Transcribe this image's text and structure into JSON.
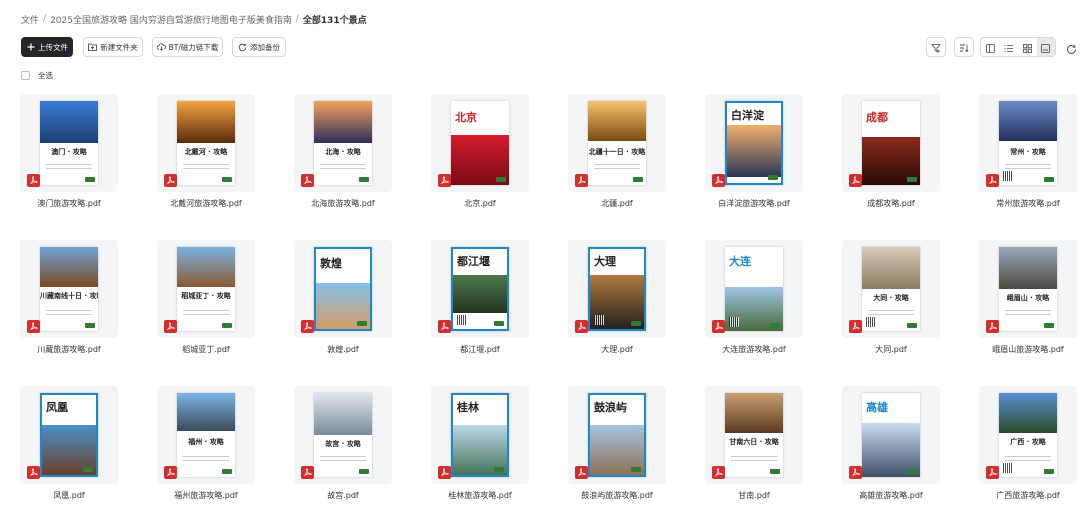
{
  "breadcrumb": {
    "root": "文件",
    "sep1": "/",
    "folder": "2025全国旅游攻略 国内穷游自驾游旅行地图电子版美食指南",
    "sep2": "/",
    "current": "全部131个景点"
  },
  "toolbar": {
    "upload": "上传文件",
    "new_folder": "新建文件夹",
    "bt_download": "BT/磁力链下载",
    "add_backup": "添加备份"
  },
  "select_all": "全选",
  "colors": {
    "primary_button": "#25262b",
    "pdf_red": "#d32f2f",
    "accent_blue": "#1e88c8"
  },
  "icons": [
    "plus-icon",
    "folder-plus-icon",
    "cloud-download-icon",
    "sync-icon",
    "filter-icon",
    "sort-icon",
    "split-view-icon",
    "list-view-icon",
    "grid-view-icon",
    "large-grid-view-icon",
    "refresh-icon",
    "pdf-icon"
  ],
  "files": [
    {
      "name": "澳门旅游攻略.pdf",
      "cover_title": "澳门 · 攻略"
    },
    {
      "name": "北戴河旅游攻略.pdf",
      "cover_title": "北戴河 · 攻略"
    },
    {
      "name": "北海旅游攻略.pdf",
      "cover_title": "北海 · 攻略"
    },
    {
      "name": "北京.pdf",
      "cover_title": "北京"
    },
    {
      "name": "北疆.pdf",
      "cover_title": "北疆十一日 · 攻略"
    },
    {
      "name": "白洋淀旅游攻略.pdf",
      "cover_title": "白洋淀"
    },
    {
      "name": "成都攻略.pdf",
      "cover_title": "成都"
    },
    {
      "name": "常州旅游攻略.pdf",
      "cover_title": "常州 · 攻略"
    },
    {
      "name": "川藏旅游攻略.pdf",
      "cover_title": "川藏南线十日 · 攻略"
    },
    {
      "name": "稻城亚丁.pdf",
      "cover_title": "稻城亚丁 · 攻略"
    },
    {
      "name": "敦煌.pdf",
      "cover_title": "敦煌"
    },
    {
      "name": "都江堰.pdf",
      "cover_title": "都江堰"
    },
    {
      "name": "大理.pdf",
      "cover_title": "大理"
    },
    {
      "name": "大连旅游攻略.pdf",
      "cover_title": "大连"
    },
    {
      "name": "大同.pdf",
      "cover_title": "大同 · 攻略"
    },
    {
      "name": "峨眉山旅游攻略.pdf",
      "cover_title": "峨眉山 · 攻略"
    },
    {
      "name": "凤凰.pdf",
      "cover_title": "凤凰"
    },
    {
      "name": "福州旅游攻略.pdf",
      "cover_title": "福州 · 攻略"
    },
    {
      "name": "故宫.pdf",
      "cover_title": "故宫 · 攻略"
    },
    {
      "name": "桂林旅游攻略.pdf",
      "cover_title": "桂林"
    },
    {
      "name": "鼓浪屿旅游攻略.pdf",
      "cover_title": "鼓浪屿"
    },
    {
      "name": "甘南.pdf",
      "cover_title": "甘南六日 · 攻略"
    },
    {
      "name": "高雄旅游攻略.pdf",
      "cover_title": "高雄"
    },
    {
      "name": "广西旅游攻略.pdf",
      "cover_title": "广西 · 攻略"
    }
  ]
}
